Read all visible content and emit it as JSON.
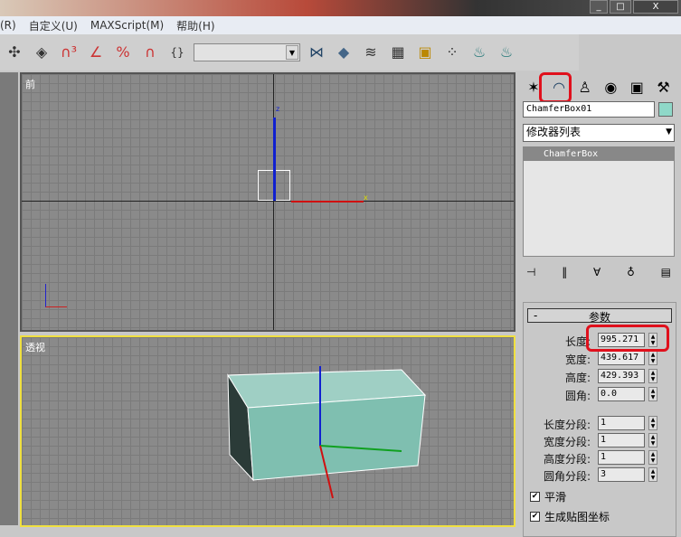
{
  "menu": [
    "(R)",
    "自定义(U)",
    "MAXScript(M)",
    "帮助(H)"
  ],
  "window_buttons": [
    "_",
    "□",
    "X"
  ],
  "toolbar_icons": [
    "link-icon",
    "box-icon",
    "snap-3-icon",
    "angle-snap-icon",
    "percent-snap-icon",
    "spinner-snap-icon",
    "named-selection-icon",
    "mirror-icon",
    "align-icon",
    "layers-icon",
    "curve-editor-icon",
    "schematic-icon",
    "material-editor-icon",
    "render-setup-icon",
    "render-icon"
  ],
  "viewports": {
    "top": {
      "label": "前"
    },
    "perspective": {
      "label": "透视"
    }
  },
  "axes": {
    "x": "x",
    "z": "z"
  },
  "panel": {
    "tabs": [
      "create-icon",
      "modify-icon",
      "hierarchy-icon",
      "motion-icon",
      "display-icon",
      "utilities-icon"
    ],
    "object_name": "ChamferBox01",
    "object_color": "#8fd8c8",
    "modifier_list": "修改器列表",
    "stack_item": "ChamferBox",
    "rollout_title": "参数",
    "rollout_toggle": "-",
    "params": [
      {
        "label": "长度:",
        "value": "995.271"
      },
      {
        "label": "宽度:",
        "value": "439.617"
      },
      {
        "label": "高度:",
        "value": "429.393"
      },
      {
        "label": "圆角:",
        "value": "0.0"
      }
    ],
    "segments": [
      {
        "label": "长度分段:",
        "value": "1"
      },
      {
        "label": "宽度分段:",
        "value": "1"
      },
      {
        "label": "高度分段:",
        "value": "1"
      },
      {
        "label": "圆角分段:",
        "value": "3"
      }
    ],
    "checkboxes": [
      {
        "label": "平滑",
        "checked": true
      },
      {
        "label": "生成贴图坐标",
        "checked": true
      }
    ]
  },
  "colors": {
    "highlight": "#e0101c",
    "active_viewport": "#f0e040",
    "box": "#7fbfb0"
  }
}
